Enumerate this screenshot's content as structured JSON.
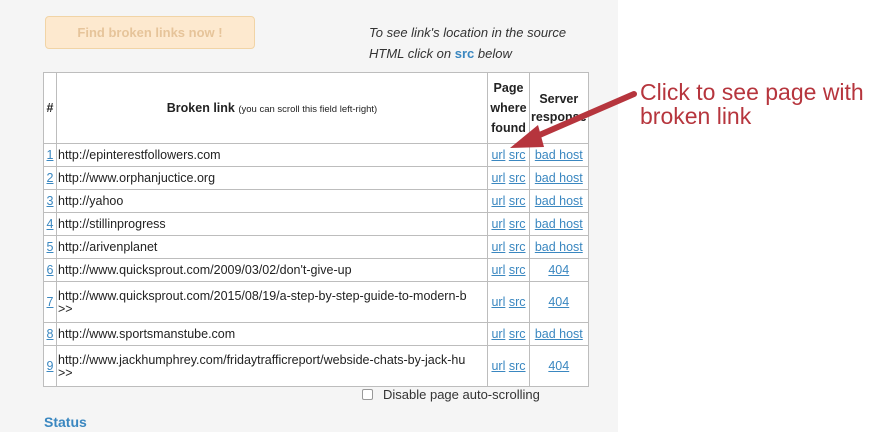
{
  "toolbar": {
    "find_button_label": "Find broken links now !"
  },
  "hint": {
    "line1": "To see link's location in the source",
    "line2_prefix": "HTML click on ",
    "src_word": "src",
    "line2_suffix": " below"
  },
  "table": {
    "headers": {
      "num": "#",
      "broken_link": "Broken link",
      "broken_link_note": "(you can scroll this field left-right)",
      "page_line1": "Page",
      "page_line2": "where",
      "page_line3": "found",
      "server_line1": "Server",
      "server_line2": "response"
    },
    "rows": [
      {
        "num": "1",
        "url": "http://epinterestfollowers.com",
        "more": "",
        "u": "url",
        "s": "src",
        "resp": "bad host"
      },
      {
        "num": "2",
        "url": "http://www.orphanjuctice.org",
        "more": "",
        "u": "url",
        "s": "src",
        "resp": "bad host"
      },
      {
        "num": "3",
        "url": "http://yahoo",
        "more": "",
        "u": "url",
        "s": "src",
        "resp": "bad host"
      },
      {
        "num": "4",
        "url": "http://stillinprogress",
        "more": "",
        "u": "url",
        "s": "src",
        "resp": "bad host"
      },
      {
        "num": "5",
        "url": "http://arivenplanet",
        "more": "",
        "u": "url",
        "s": "src",
        "resp": "bad host"
      },
      {
        "num": "6",
        "url": "http://www.quicksprout.com/2009/03/02/don't-give-up",
        "more": "",
        "u": "url",
        "s": "src",
        "resp": "404"
      },
      {
        "num": "7",
        "url": "http://www.quicksprout.com/2015/08/19/a-step-by-step-guide-to-modern-b",
        "more": ">>",
        "u": "url",
        "s": "src",
        "resp": "404"
      },
      {
        "num": "8",
        "url": "http://www.sportsmanstube.com",
        "more": "",
        "u": "url",
        "s": "src",
        "resp": "bad host"
      },
      {
        "num": "9",
        "url": "http://www.jackhumphrey.com/fridaytrafficreport/webside-chats-by-jack-hu",
        "more": ">>",
        "u": "url",
        "s": "src",
        "resp": "404"
      }
    ]
  },
  "options": {
    "disable_autoscroll_label": "Disable page auto-scrolling"
  },
  "status": {
    "label": "Status"
  },
  "annotation": {
    "callout_text": "Click to see page with broken link",
    "color": "#b6353d"
  }
}
